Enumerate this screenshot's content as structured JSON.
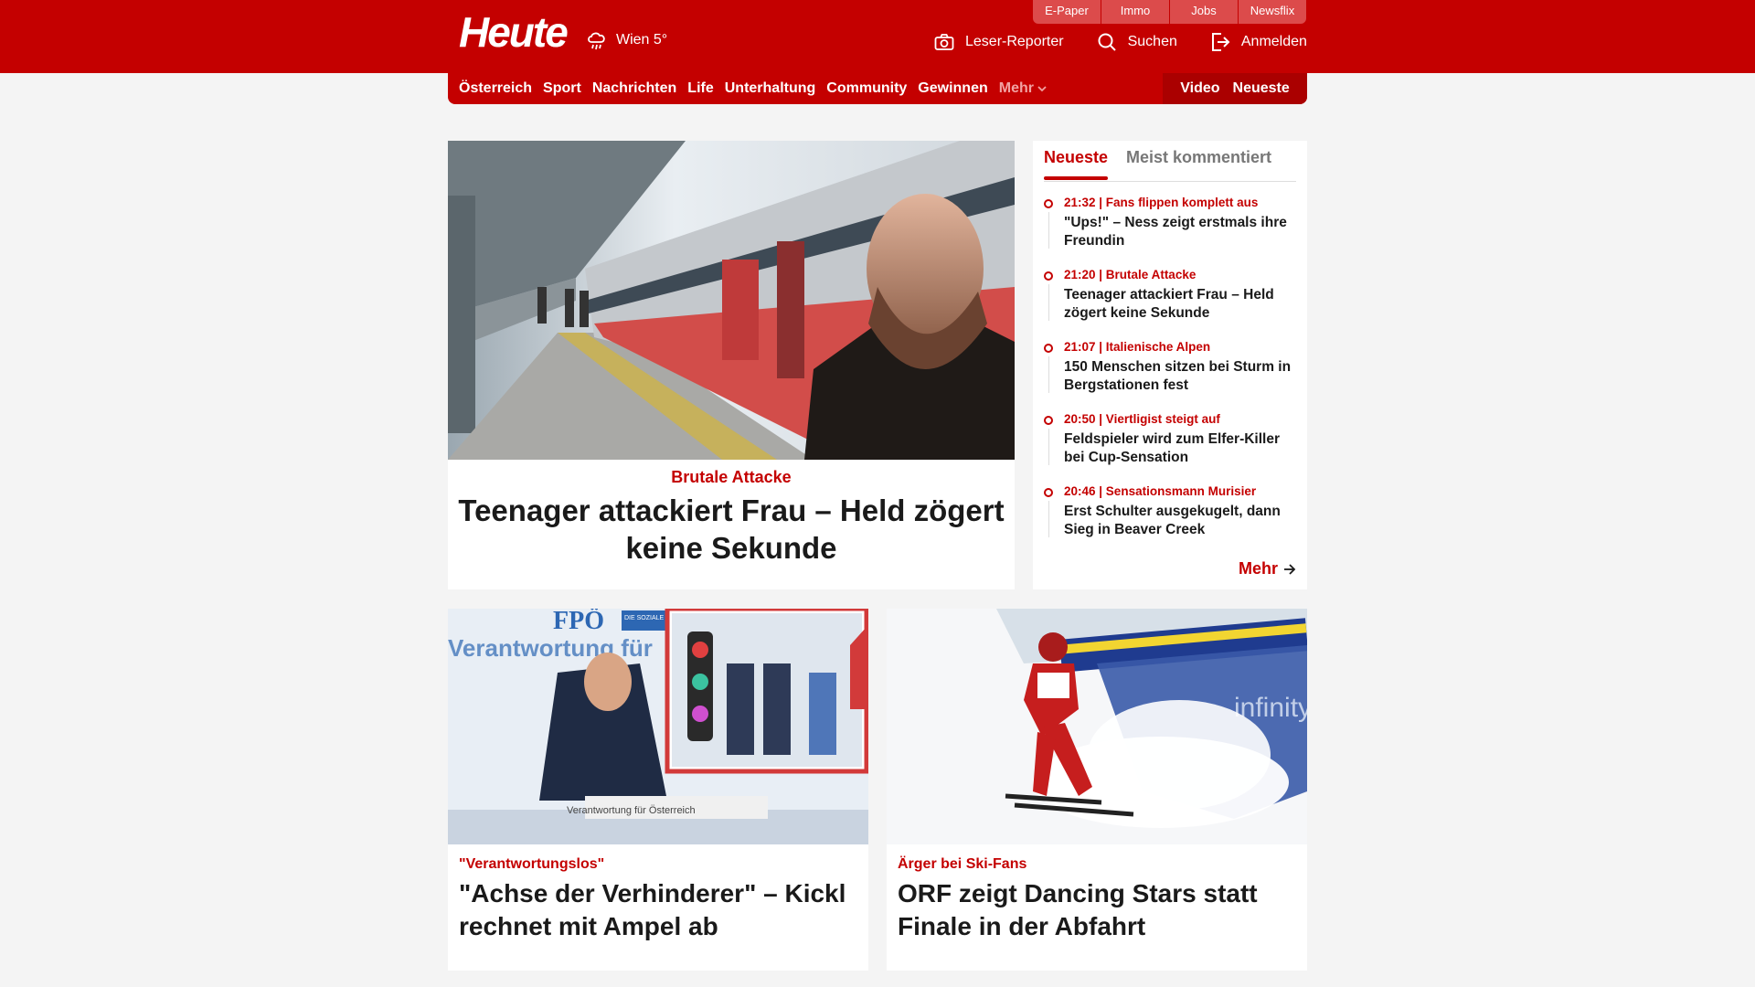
{
  "header": {
    "logo_text": "Heute",
    "weather": {
      "city_temp": "Wien 5°",
      "icon": "rain-cloud-icon"
    },
    "service_links": [
      "E-Paper",
      "Immo",
      "Jobs",
      "Newsflix"
    ],
    "actions": [
      {
        "label": "Leser-Reporter",
        "icon": "camera-icon"
      },
      {
        "label": "Suchen",
        "icon": "search-icon"
      },
      {
        "label": "Anmelden",
        "icon": "login-icon"
      }
    ],
    "colors": {
      "brand": "#c40000",
      "brand_dark": "#aa0000",
      "service_bg": "#dc4b4b"
    }
  },
  "nav": {
    "items": [
      "Österreich",
      "Sport",
      "Nachrichten",
      "Life",
      "Unterhaltung",
      "Community",
      "Gewinnen"
    ],
    "more_label": "Mehr",
    "right_items": [
      "Video",
      "Neueste"
    ]
  },
  "hero": {
    "kicker": "Brutale Attacke",
    "headline": "Teenager attackiert Frau – Held zögert keine Sekunde"
  },
  "sidebar": {
    "tabs": [
      "Neueste",
      "Meist kommentiert"
    ],
    "feed": [
      {
        "meta": "21:32 | Fans flippen komplett aus",
        "title": "\"Ups!\" – Ness zeigt erstmals ihre Freundin"
      },
      {
        "meta": "21:20 | Brutale Attacke",
        "title": "Teenager attackiert Frau – Held zögert keine Sekunde"
      },
      {
        "meta": "21:07 | Italienische Alpen",
        "title": "150 Menschen sitzen bei Sturm in Bergstationen fest"
      },
      {
        "meta": "20:50 | Viertligist steigt auf",
        "title": "Feldspieler wird zum Elfer-Killer bei Cup-Sensation"
      },
      {
        "meta": "20:46 | Sensationsmann Murisier",
        "title": "Erst Schulter ausgekugelt, dann Sieg in Beaver Creek"
      }
    ],
    "more_label": "Mehr"
  },
  "articles": [
    {
      "kicker": "\"Verantwortungslos\"",
      "headline": "\"Achse der Verhinderer\" – Kickl rechnet mit Ampel ab",
      "image_text": [
        "FPÖ",
        "Verantwortung für",
        "DIE SOZIALE HEIMATPARTEI",
        "Verantwortung für Österreich"
      ]
    },
    {
      "kicker": "Ärger bei Ski-Fans",
      "headline": "ORF zeigt Dancing Stars statt Finale in der Abfahrt",
      "image_text": [
        "infinity"
      ]
    }
  ]
}
